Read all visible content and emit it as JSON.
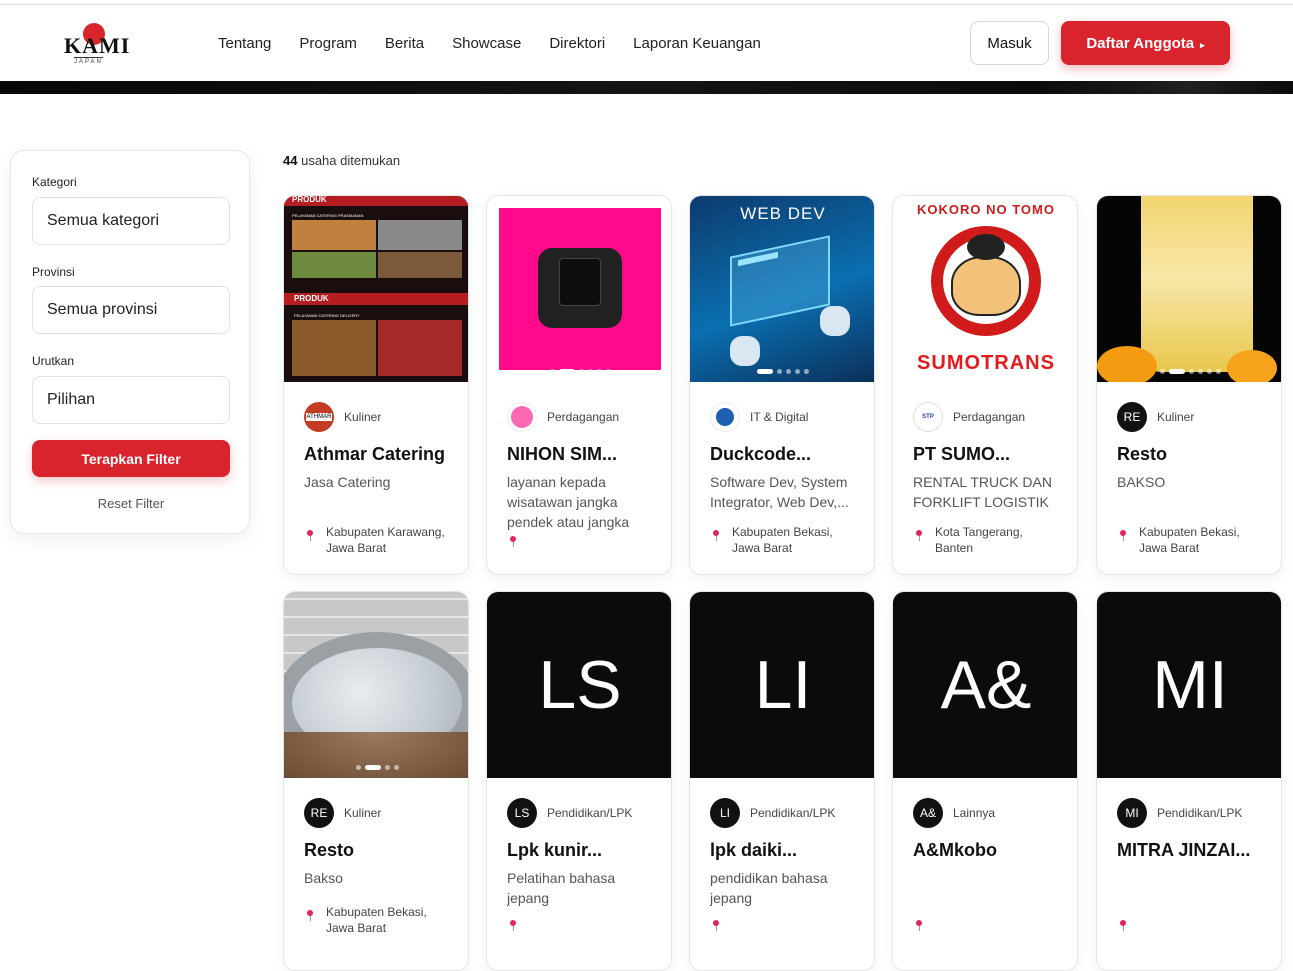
{
  "header": {
    "logo": {
      "word": "KAMI",
      "sub": "JAPAN"
    },
    "nav": [
      "Tentang",
      "Program",
      "Berita",
      "Showcase",
      "Direktori",
      "Laporan Keuangan"
    ],
    "login_label": "Masuk",
    "register_label": "Daftar Anggota"
  },
  "filter": {
    "category_label": "Kategori",
    "category_value": "Semua kategori",
    "province_label": "Provinsi",
    "province_value": "Semua provinsi",
    "sort_label": "Urutkan",
    "sort_value": "Pilihan",
    "apply_label": "Terapkan Filter",
    "reset_label": "Reset Filter"
  },
  "results": {
    "count": "44",
    "suffix": "usaha ditemukan"
  },
  "cards": [
    {
      "category": "Kuliner",
      "title": "Athmar Catering",
      "desc": "Jasa Catering",
      "loc1": "Kabupaten Karawang,",
      "loc2": "Jawa Barat",
      "media": {
        "labels": [
          "PRODUK",
          "PELAYANAN CATERING PRASMANAN",
          "PRODUK",
          "PELAYANAN CATERING DELIVERY"
        ]
      }
    },
    {
      "category": "Perdagangan",
      "title": "NIHON SIM...",
      "desc": "layanan kepada wisatawan jangka pendek atau jangka",
      "loc1": "",
      "loc2": ""
    },
    {
      "category": "IT & Digital",
      "title": "Duckcode...",
      "desc": "Software Dev, System Integrator, Web Dev,...",
      "loc1": "Kabupaten Bekasi,",
      "loc2": "Jawa Barat",
      "media": {
        "heading": "WEB DEV"
      }
    },
    {
      "category": "Perdagangan",
      "title": "PT SUMO...",
      "desc": "RENTAL TRUCK DAN FORKLIFT LOGISTIK",
      "loc1": "Kota Tangerang,",
      "loc2": "Banten",
      "media": {
        "arc": "KOKORO NO TOMO",
        "banner": "SUMOTRANS"
      }
    },
    {
      "category": "Kuliner",
      "avatar": "RE",
      "title": "Resto",
      "desc": "BAKSO",
      "loc1": "Kabupaten Bekasi,",
      "loc2": "Jawa Barat"
    },
    {
      "category": "Kuliner",
      "avatar": "RE",
      "title": "Resto",
      "desc": "Bakso",
      "loc1": "Kabupaten Bekasi,",
      "loc2": "Jawa Barat"
    },
    {
      "category": "Pendidikan/LPK",
      "avatar": "LS",
      "initials": "LS",
      "title": "Lpk kunir...",
      "desc": "Pelatihan bahasa jepang",
      "loc1": "",
      "loc2": ""
    },
    {
      "category": "Pendidikan/LPK",
      "avatar": "LI",
      "initials": "LI",
      "title": "lpk daiki...",
      "desc": "pendidikan bahasa jepang",
      "loc1": "",
      "loc2": ""
    },
    {
      "category": "Lainnya",
      "avatar": "A&",
      "initials": "A&",
      "title": "A&Mkobo",
      "desc": "",
      "loc1": "",
      "loc2": ""
    },
    {
      "category": "Pendidikan/LPK",
      "avatar": "MI",
      "initials": "MI",
      "title": "MITRA JINZAI...",
      "desc": "",
      "loc1": "",
      "loc2": ""
    }
  ],
  "colors": {
    "accent": "#d9232d",
    "pin": "#e0245e"
  }
}
